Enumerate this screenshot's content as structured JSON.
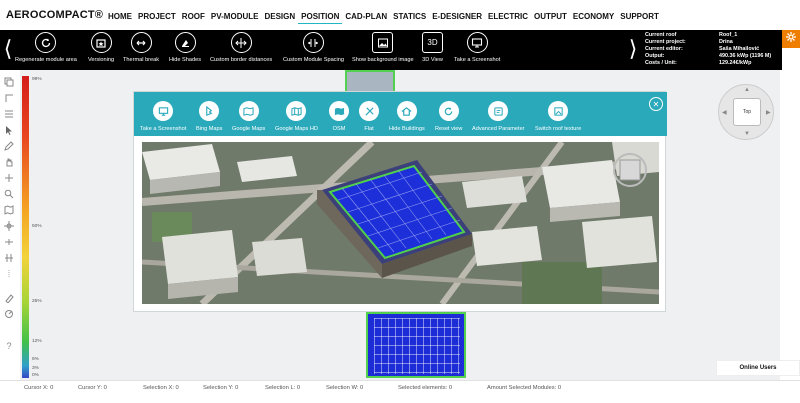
{
  "app": {
    "logo": "AEROCOMPACT®"
  },
  "nav": {
    "items": [
      "HOME",
      "PROJECT",
      "ROOF",
      "PV-MODULE",
      "DESIGN",
      "POSITION",
      "CAD-PLAN",
      "STATICS",
      "E-DESIGNER",
      "ELECTRIC",
      "OUTPUT",
      "ECONOMY",
      "SUPPORT"
    ],
    "active": "POSITION"
  },
  "toolbar": {
    "prev_arrow": "⟨",
    "next_arrow": "⟩",
    "items": [
      {
        "label": "Regenerate module area",
        "icon": "refresh-icon"
      },
      {
        "label": "Versioning",
        "icon": "versioning-icon"
      },
      {
        "label": "Thermal break",
        "icon": "thermal-break-icon"
      },
      {
        "label": "Hide Shades",
        "icon": "hide-shades-icon"
      },
      {
        "label": "Custom border distances",
        "icon": "border-distance-icon"
      },
      {
        "label": "Custom Module Spacing",
        "icon": "module-spacing-icon"
      },
      {
        "label": "Show background image",
        "icon": "image-icon"
      },
      {
        "label": "3D View",
        "icon": "3d-icon",
        "text": "3D"
      },
      {
        "label": "Take a Screenshot",
        "icon": "monitor-icon"
      }
    ]
  },
  "info_panel": {
    "rows": [
      {
        "key": "Current roof",
        "value": "Roof_1"
      },
      {
        "key": "Current project:",
        "value": "Drina"
      },
      {
        "key": "Current editor:",
        "value": "Saša Mihailović"
      },
      {
        "key": "Output:",
        "value": "490.36 kWp (1196 M)"
      },
      {
        "key": "Costs / Unit:",
        "value": "129.24€/kWp"
      }
    ]
  },
  "color_scale": {
    "labels": [
      "99%",
      "50%",
      "25%",
      "12%",
      "6%",
      "3%",
      "0%"
    ]
  },
  "compass": {
    "top_label": "Top"
  },
  "modal": {
    "items": [
      {
        "label": "Take a Screenshot",
        "icon": "monitor-icon"
      },
      {
        "label": "Bing Maps",
        "icon": "bing-icon"
      },
      {
        "label": "Google Maps",
        "icon": "map-icon"
      },
      {
        "label": "Google Maps HD",
        "icon": "map-hd-icon"
      },
      {
        "label": "OSM",
        "icon": "osm-icon"
      },
      {
        "label": "Flat",
        "icon": "flat-icon"
      },
      {
        "label": "Hide Buildings",
        "icon": "home-icon"
      },
      {
        "label": "Reset view",
        "icon": "reset-icon"
      },
      {
        "label": "Advanced Parameter",
        "icon": "advanced-icon"
      },
      {
        "label": "Switch roof texture",
        "icon": "texture-icon"
      }
    ],
    "close": "✕"
  },
  "status_bar": {
    "cursor_x": "Cursor X:  0",
    "cursor_y": "Cursor Y:  0",
    "selection_x": "Selection X:  0",
    "selection_y": "Selection Y:  0",
    "selection_l": "Selection L:  0",
    "selection_w": "Selection W:  0",
    "selected_elements": "Selected elements:  0",
    "selected_modules": "Amount Selected Modules:  0"
  },
  "online_users": "Online Users",
  "colors": {
    "accent": "#2aa9bb",
    "toolbar_bg": "#000000",
    "settings": "#ef7d00",
    "module_fill": "#1c2cd6",
    "module_border": "#52d04f"
  }
}
